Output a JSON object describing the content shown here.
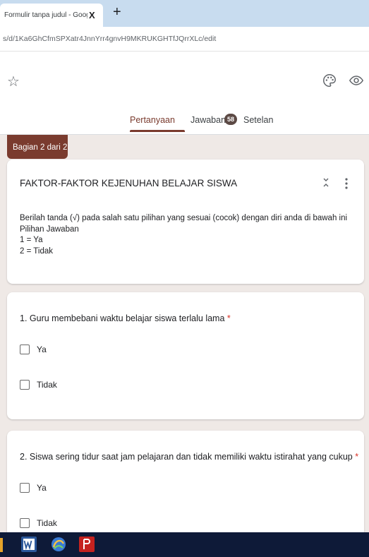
{
  "browser": {
    "tab_title": "Formulir tanpa judul - Google Fo",
    "tab_close": "X",
    "new_tab": "+",
    "url": "s/d/1Ka6GhCfmSPXatr4JnnYrr4gnvH9MKRUKGHTfJQrrXLc/edit"
  },
  "header": {
    "star_glyph": "☆",
    "palette_icon": "palette-icon",
    "preview_icon": "eye-icon"
  },
  "tabs": {
    "questions": "Pertanyaan",
    "responses": "Jawaban",
    "responses_count": "58",
    "settings": "Setelan"
  },
  "colors": {
    "accent": "#7a3b2e",
    "background": "#efe9e6",
    "required": "#d93025"
  },
  "section": {
    "label": "Bagian 2 dari 2",
    "title": "FAKTOR-FAKTOR KEJENUHAN BELAJAR SISWA",
    "description": [
      "Berilah tanda (√) pada salah satu pilihan yang sesuai (cocok) dengan diri anda di bawah ini",
      "Pilihan Jawaban",
      "1 = Ya",
      "2 = Tidak"
    ]
  },
  "questions": [
    {
      "title": "1. Guru membebani waktu belajar siswa terlalu lama",
      "required": "*",
      "options": [
        "Ya",
        "Tidak"
      ]
    },
    {
      "title": "2. Siswa sering tidur saat jam pelajaran dan tidak memiliki waktu istirahat yang cukup",
      "required": "*",
      "options": [
        "Ya",
        "Tidak"
      ]
    }
  ],
  "taskbar": {
    "items": [
      "word-icon",
      "media-player-icon",
      "pdf-icon"
    ]
  }
}
